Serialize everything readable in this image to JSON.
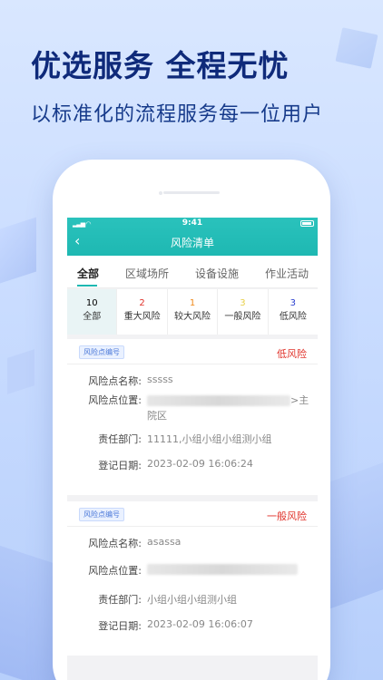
{
  "hero": {
    "title": "优选服务 全程无忧",
    "subtitle": "以标准化的流程服务每一位用户"
  },
  "status_bar": {
    "time": "9:41"
  },
  "nav": {
    "title": "风险清单",
    "back_icon": "‹"
  },
  "tabs": [
    {
      "label": "全部",
      "active": true
    },
    {
      "label": "区域场所",
      "active": false
    },
    {
      "label": "设备设施",
      "active": false
    },
    {
      "label": "作业活动",
      "active": false
    }
  ],
  "stats": [
    {
      "num": "10",
      "label": "全部",
      "color": "#333333",
      "active": true
    },
    {
      "num": "2",
      "label": "重大风险",
      "color": "#e0322a",
      "active": false
    },
    {
      "num": "1",
      "label": "较大风险",
      "color": "#f08a1c",
      "active": false
    },
    {
      "num": "3",
      "label": "一般风险",
      "color": "#e8d04a",
      "active": false
    },
    {
      "num": "3",
      "label": "低风险",
      "color": "#2a3fcf",
      "active": false
    }
  ],
  "cards": [
    {
      "tag": "风险点编号",
      "level": "低风险",
      "level_color": "#e0322a",
      "name_label": "风险点名称:",
      "name": "sssss",
      "location_label": "风险点位置:",
      "location_suffix": ">主",
      "location_line2": "院区",
      "dept_label": "责任部门:",
      "dept": "11111,小组小组小组测小组",
      "date_label": "登记日期:",
      "date": "2023-02-09 16:06:24"
    },
    {
      "tag": "风险点编号",
      "level": "一般风险",
      "level_color": "#e0322a",
      "name_label": "风险点名称:",
      "name": "asassa",
      "location_label": "风险点位置:",
      "dept_label": "责任部门:",
      "dept": "小组小组小组测小组",
      "date_label": "登记日期:",
      "date": "2023-02-09 16:06:07"
    }
  ]
}
